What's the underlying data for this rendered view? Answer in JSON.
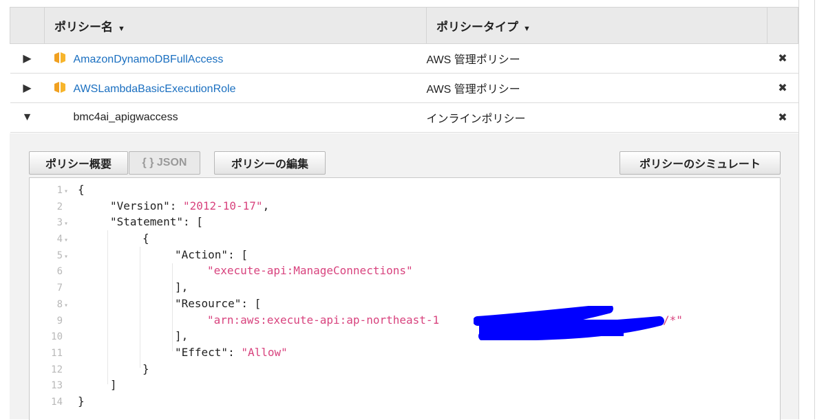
{
  "table": {
    "headers": {
      "name": "ポリシー名",
      "type": "ポリシータイプ"
    },
    "rows": [
      {
        "name": "AmazonDynamoDBFullAccess",
        "type": "AWS 管理ポリシー"
      },
      {
        "name": "AWSLambdaBasicExecutionRole",
        "type": "AWS 管理ポリシー"
      },
      {
        "name": "bmc4ai_apigwaccess",
        "type": "インラインポリシー"
      }
    ]
  },
  "toolbar": {
    "summary": "ポリシー概要",
    "json": "{ } JSON",
    "edit": "ポリシーの編集",
    "simulate": "ポリシーのシミュレート"
  },
  "code": {
    "l1": "{",
    "l2k": "\"Version\": ",
    "l2v": "\"2012-10-17\"",
    "l2e": ",",
    "l3k": "\"Statement\": [",
    "l4": "{",
    "l5k": "\"Action\": [",
    "l6v": "\"execute-api:ManageConnections\"",
    "l7": "],",
    "l8k": "\"Resource\": [",
    "l9v": "\"arn:aws:execute-api:ap-northeast-1",
    "l9t": "/*\"",
    "l10": "],",
    "l11k": "\"Effect\": ",
    "l11v": "\"Allow\"",
    "l12": "}",
    "l13": "]",
    "l14": "}"
  },
  "icons": {
    "policy": "orange-cube-icon",
    "expand": "triangle-right-icon",
    "collapse": "triangle-down-icon",
    "remove": "x-icon",
    "sort": "caret-down-icon"
  },
  "colors": {
    "link": "#1a6fc0",
    "string": "#d8437e",
    "redaction": "#0000ff",
    "policy_icon": "#f0a020"
  }
}
